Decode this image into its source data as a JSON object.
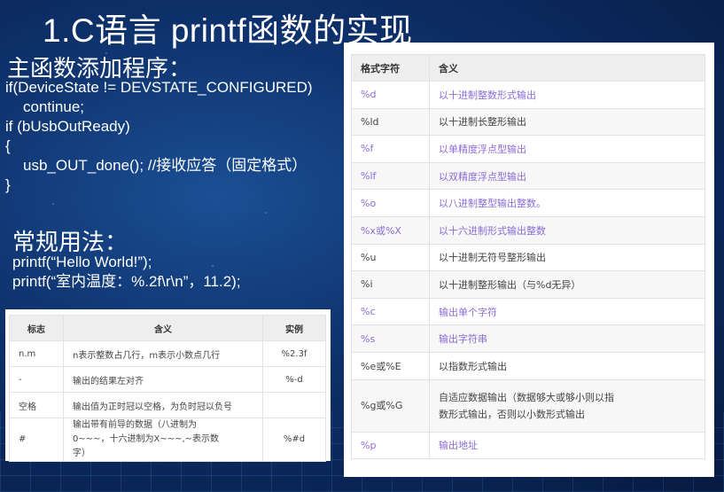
{
  "slide": {
    "title": "1.C语言 printf函数的实现",
    "subtitle1": "主函数添加程序：",
    "code_lines": [
      "if(DeviceState != DEVSTATE_CONFIGURED)",
      "    continue;",
      "if (bUsbOutReady)",
      "{",
      "    usb_OUT_done();     //接收应答（固定格式）",
      "}"
    ],
    "subtitle2": "常规用法：",
    "usage_lines": [
      "printf(“Hello World!”);",
      "printf(“室内温度：%.2f\\r\\n”，11.2);"
    ]
  },
  "format_table": {
    "headers": [
      "格式字符",
      "含义"
    ],
    "rows": [
      [
        "%d",
        "以十进制整数形式输出"
      ],
      [
        "%ld",
        "以十进制长整形输出"
      ],
      [
        "%f",
        "以单精度浮点型输出"
      ],
      [
        "%lf",
        "以双精度浮点型输出"
      ],
      [
        "%o",
        "以八进制整型输出整数。"
      ],
      [
        "%x或%X",
        "以十六进制形式输出整数"
      ],
      [
        "%u",
        "以十进制无符号整形输出"
      ],
      [
        "%i",
        "以十进制整形输出（与%d无异）"
      ],
      [
        "%c",
        "输出单个字符"
      ],
      [
        "%s",
        "输出字符串"
      ],
      [
        "%e或%E",
        "以指数形式输出"
      ],
      [
        "%g或%G",
        "自适应数据输出（数据够大或够小则以指数形式输出，否则以小数形式输出"
      ],
      [
        "%p",
        "输出地址"
      ]
    ]
  },
  "flag_table": {
    "headers": [
      "标志",
      "含义",
      "实例"
    ],
    "rows": [
      [
        "n.m",
        "n表示整数占几行，m表示小数点几行",
        "%2.3f"
      ],
      [
        "-",
        "输出的结果左对齐",
        "%-d"
      ],
      [
        "空格",
        "输出值为正时冠以空格，为负时冠以负号",
        ""
      ],
      [
        "#",
        "输出带有前导的数据（八进制为0~~~，十六进制为X~~~,~表示数字）",
        "%#d"
      ]
    ]
  }
}
